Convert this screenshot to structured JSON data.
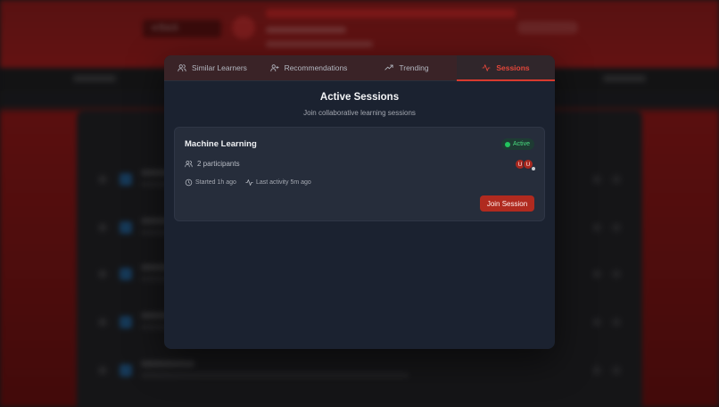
{
  "background": {
    "back_label": "◂ Back"
  },
  "modal": {
    "tabs": [
      {
        "label": "Similar Learners",
        "icon": "users-icon",
        "active": false
      },
      {
        "label": "Recommendations",
        "icon": "user-plus-icon",
        "active": false
      },
      {
        "label": "Trending",
        "icon": "trending-up-icon",
        "active": false
      },
      {
        "label": "Sessions",
        "icon": "activity-icon",
        "active": true
      }
    ],
    "heading": "Active Sessions",
    "subheading": "Join collaborative learning sessions",
    "sessions": [
      {
        "title": "Machine Learning",
        "status": "Active",
        "participants": "2 participants",
        "avatars": [
          "U",
          "U"
        ],
        "started": "Started 1h ago",
        "last_activity": "Last activity 5m ago",
        "join_label": "Join Session"
      }
    ]
  },
  "colors": {
    "accent": "#d83a2e",
    "button": "#b02a1f",
    "status_active": "#22c55e",
    "modal_bg": "#1b2230",
    "card_bg": "#262d3b"
  }
}
